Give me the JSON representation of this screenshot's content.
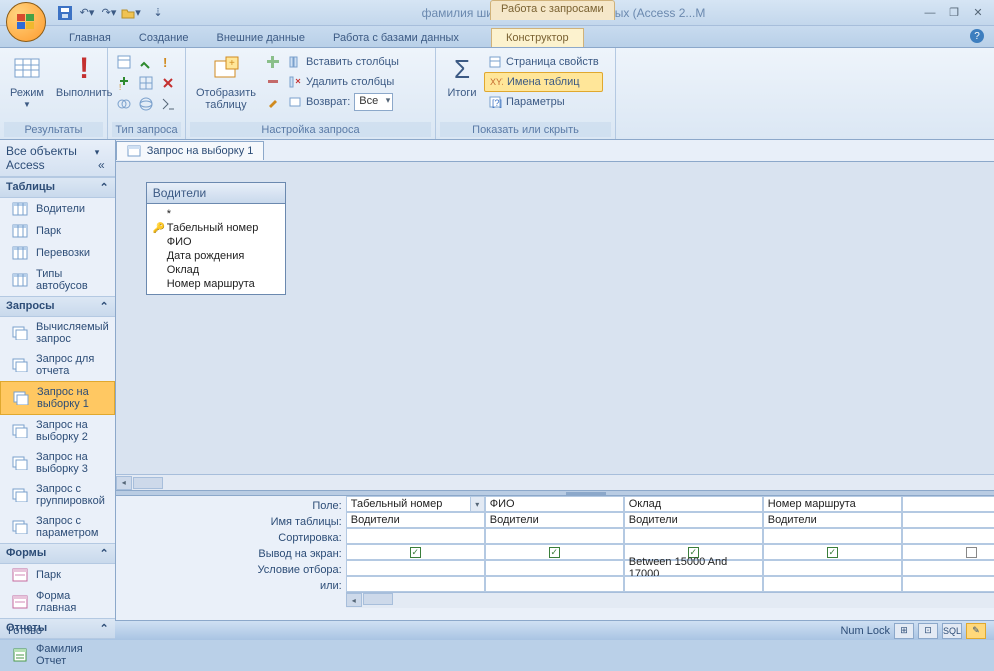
{
  "window": {
    "title": "фамилия шифр 16 вар : база данных (Access 2...M"
  },
  "context_tab_group": "Работа с запросами",
  "tabs": {
    "home": "Главная",
    "create": "Создание",
    "external": "Внешние данные",
    "dbtools": "Работа с базами данных",
    "design": "Конструктор"
  },
  "ribbon": {
    "group_results": "Результаты",
    "mode": "Режим",
    "run": "Выполнить",
    "group_querytype": "Тип запроса",
    "group_querysetup": "Настройка запроса",
    "show_table": "Отобразить\nтаблицу",
    "insert_cols": "Вставить столбцы",
    "delete_cols": "Удалить столбцы",
    "return": "Возврат:",
    "return_val": "Все",
    "group_showhide": "Показать или скрыть",
    "totals": "Итоги",
    "prop_sheet": "Страница свойств",
    "table_names": "Имена таблиц",
    "params": "Параметры"
  },
  "nav": {
    "header": "Все объекты Access",
    "g_tables": "Таблицы",
    "tables": [
      "Водители",
      "Парк",
      "Перевозки",
      "Типы автобусов"
    ],
    "g_queries": "Запросы",
    "queries": [
      "Вычисляемый запрос",
      "Запрос для отчета",
      "Запрос на выборку 1",
      "Запрос на выборку 2",
      "Запрос на выборку 3",
      "Запрос с группировкой",
      "Запрос с параметром"
    ],
    "g_forms": "Формы",
    "forms": [
      "Парк",
      "Форма главная"
    ],
    "g_reports": "Отчеты",
    "reports": [
      "Фамилия Отчет"
    ],
    "selected_query": "Запрос на выборку 1"
  },
  "doc_tab": "Запрос на выборку 1",
  "table_box": {
    "name": "Водители",
    "fields": [
      "*",
      "Табельный номер",
      "ФИО",
      "Дата рождения",
      "Оклад",
      "Номер маршрута"
    ],
    "pk_index": 1
  },
  "grid": {
    "labels": {
      "field": "Поле:",
      "table": "Имя таблицы:",
      "sort": "Сортировка:",
      "show": "Вывод на экран:",
      "criteria": "Условие отбора:",
      "or": "или:"
    },
    "cols": [
      {
        "field": "Табельный номер",
        "tbl": "Водители",
        "show": true,
        "crit": "",
        "has_dd": true
      },
      {
        "field": "ФИО",
        "tbl": "Водители",
        "show": true,
        "crit": ""
      },
      {
        "field": "Оклад",
        "tbl": "Водители",
        "show": true,
        "crit": "Between 15000 And 17000"
      },
      {
        "field": "Номер маршрута",
        "tbl": "Водители",
        "show": true,
        "crit": ""
      },
      {
        "field": "",
        "tbl": "",
        "show": false,
        "crit": ""
      }
    ]
  },
  "status": {
    "left": "Готово",
    "numlock": "Num Lock",
    "views": [
      "⊞",
      "⊡",
      "SQL",
      "✎"
    ]
  }
}
